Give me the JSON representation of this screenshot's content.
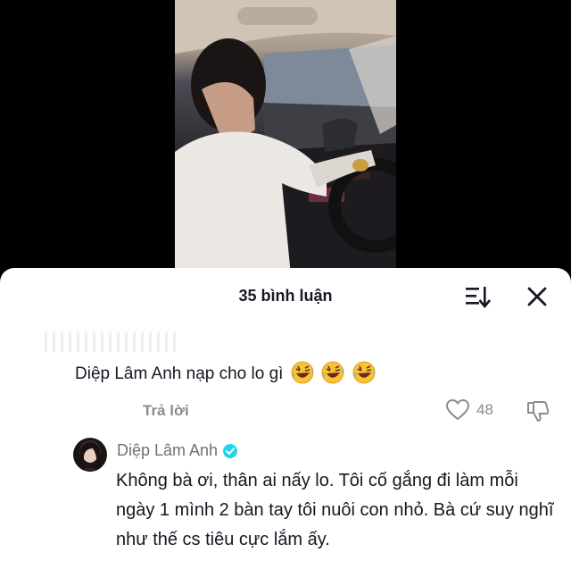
{
  "sheet": {
    "comment_count": "35 bình luận"
  },
  "comment": {
    "text": "Diệp Lâm Anh nạp cho lo gì",
    "emojis": [
      "rolling-on-floor-laughing",
      "rolling-on-floor-laughing",
      "rolling-on-floor-laughing"
    ],
    "reply_label": "Trả lời",
    "like_count": "48"
  },
  "reply": {
    "author": "Diệp Lâm Anh",
    "verified": true,
    "text": "Không bà ơi, thân ai nấy lo. Tôi cố gắng đi làm mỗi ngày 1 mình 2 bàn tay tôi nuôi con nhỏ. Bà cứ suy nghĩ như thế cs tiêu cực lắm ấy."
  },
  "colors": {
    "accent_verified": "#20d5ec",
    "text_primary": "#161823",
    "text_secondary": "#8a8b91"
  }
}
